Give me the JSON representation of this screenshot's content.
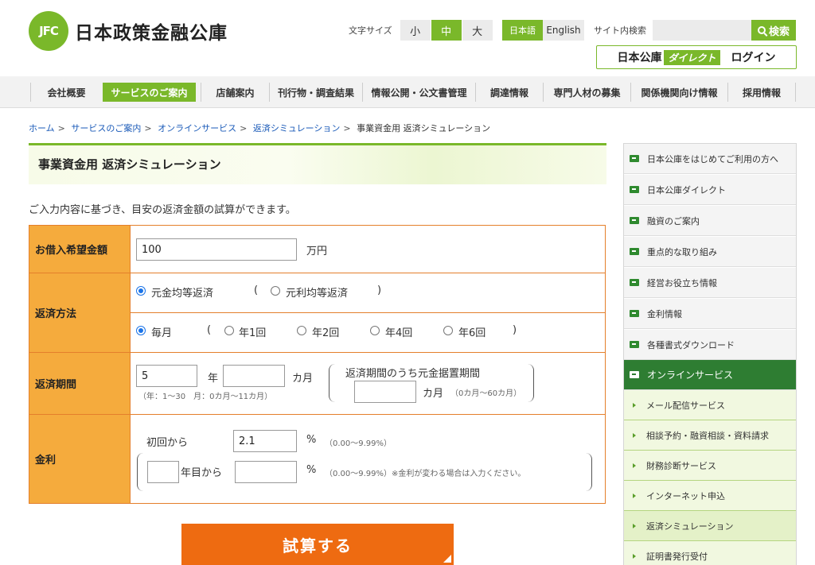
{
  "header": {
    "logo_mark": "JFC",
    "logo_text": "日本政策金融公庫",
    "font_size_label": "文字サイズ",
    "font_sizes": [
      "小",
      "中",
      "大"
    ],
    "font_size_selected": "中",
    "languages": [
      "日本語",
      "English"
    ],
    "search_label": "サイト内検索",
    "search_placeholder": "",
    "search_button": "検索",
    "direct_prefix": "日本公庫",
    "direct_badge": "ダイレクト",
    "direct_login": "ログイン"
  },
  "nav": {
    "items": [
      "会社概要",
      "サービスのご案内",
      "店舗案内",
      "刊行物・調査結果",
      "情報公開・公文書管理",
      "調達情報",
      "専門人材の募集",
      "関係機関向け情報",
      "採用情報"
    ],
    "active": "サービスのご案内"
  },
  "breadcrumb": {
    "links": [
      "ホーム",
      "サービスのご案内",
      "オンラインサービス",
      "返済シミュレーション"
    ],
    "current": "事業資金用 返済シミュレーション",
    "separator": ">"
  },
  "page": {
    "title": "事業資金用 返済シミュレーション",
    "lead": "ご入力内容に基づき、目安の返済金額の試算ができます。"
  },
  "form": {
    "loan": {
      "label": "お借入希望金額",
      "value": "100",
      "unit": "万円"
    },
    "method": {
      "label": "返済方法",
      "type_options": [
        "元金均等返済",
        "元利均等返済"
      ],
      "type_selected": "元金均等返済",
      "freq_options": [
        "毎月",
        "年1回",
        "年2回",
        "年4回",
        "年6回"
      ],
      "freq_selected": "毎月",
      "paren_open": "(",
      "paren_close": ")"
    },
    "period": {
      "label": "返済期間",
      "years_value": "5",
      "years_unit": "年",
      "months_value": "",
      "months_unit": "カ月",
      "hint": "（年：1〜30　月：0カ月〜11カ月）",
      "grace_label": "返済期間のうち元金据置期間",
      "grace_value": "",
      "grace_unit": "カ月",
      "grace_hint": "（0カ月〜60カ月）"
    },
    "rate": {
      "label": "金利",
      "initial_label": "初回から",
      "initial_value": "2.1",
      "percent": "%",
      "initial_hint": "（0.00〜9.99%）",
      "year_value": "",
      "year_suffix": "年目から",
      "second_value": "",
      "second_hint": "（0.00〜9.99%）※金利が変わる場合は入力ください。"
    },
    "submit": "試算する"
  },
  "sidebar": {
    "items": [
      "日本公庫をはじめてご利用の方へ",
      "日本公庫ダイレクト",
      "融資のご案内",
      "重点的な取り組み",
      "経営お役立ち情報",
      "金利情報",
      "各種書式ダウンロード",
      "オンラインサービス"
    ],
    "active": "オンラインサービス",
    "sub_items": [
      "メール配信サービス",
      "相談予約・融資相談・資料請求",
      "財務診断サービス",
      "インターネット申込",
      "返済シミュレーション",
      "証明書発行受付"
    ],
    "sub_current": "返済シミュレーション"
  },
  "colors": {
    "brand_green": "#7ab82a",
    "dark_green": "#2e7d32",
    "form_header": "#f5ab3d",
    "form_border": "#e47f2b",
    "submit": "#ee6b11",
    "link": "#1a5ab8"
  }
}
